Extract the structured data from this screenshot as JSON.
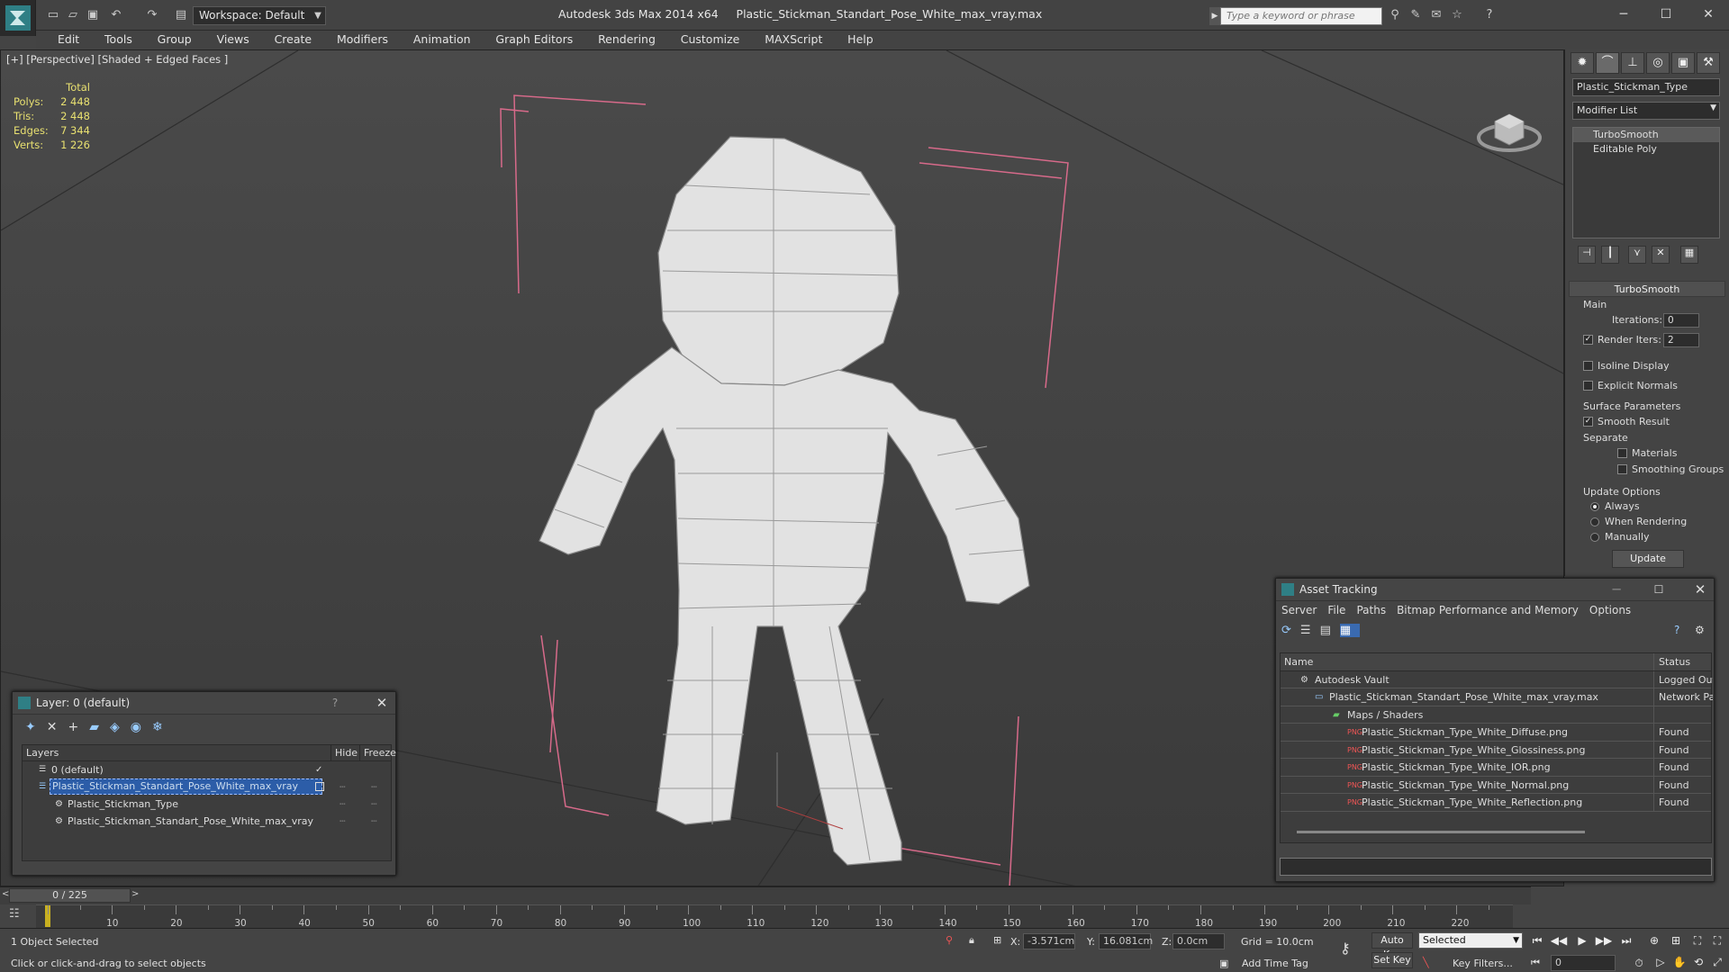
{
  "titlebar": {
    "workspace": "Workspace: Default",
    "app_name": "Autodesk 3ds Max  2014 x64",
    "file_name": "Plastic_Stickman_Standart_Pose_White_max_vray.max",
    "search_placeholder": "Type a keyword or phrase"
  },
  "menu": [
    "Edit",
    "Tools",
    "Group",
    "Views",
    "Create",
    "Modifiers",
    "Animation",
    "Graph Editors",
    "Rendering",
    "Customize",
    "MAXScript",
    "Help"
  ],
  "viewport": {
    "label": "[+] [Perspective] [Shaded + Edged Faces ]",
    "stats": {
      "header": "Total",
      "polys_label": "Polys:",
      "polys": "2 448",
      "tris_label": "Tris:",
      "tris": "2 448",
      "edges_label": "Edges:",
      "edges": "7 344",
      "verts_label": "Verts:",
      "verts": "1 226"
    }
  },
  "command_panel": {
    "object_name": "Plastic_Stickman_Type",
    "modifier_list": "Modifier List",
    "stack": [
      "TurboSmooth",
      "Editable Poly"
    ],
    "rollout_title": "TurboSmooth",
    "main_label": "Main",
    "iterations_label": "Iterations:",
    "iterations": "0",
    "render_iters_label": "Render Iters:",
    "render_iters": "2",
    "isoline_label": "Isoline Display",
    "explicit_normals_label": "Explicit Normals",
    "surface_params_label": "Surface Parameters",
    "smooth_result_label": "Smooth Result",
    "separate_label": "Separate",
    "materials_label": "Materials",
    "smoothing_groups_label": "Smoothing Groups",
    "update_options_label": "Update Options",
    "always_label": "Always",
    "when_rendering_label": "When Rendering",
    "manually_label": "Manually",
    "update_button": "Update"
  },
  "layer_window": {
    "title": "Layer: 0 (default)",
    "help": "?",
    "columns": {
      "layers": "Layers",
      "hide": "Hide",
      "freeze": "Freeze"
    },
    "rows": [
      {
        "name": "0 (default)",
        "indent": 0
      },
      {
        "name": "Plastic_Stickman_Standart_Pose_White_max_vray",
        "indent": 0
      },
      {
        "name": "Plastic_Stickman_Type",
        "indent": 1
      },
      {
        "name": "Plastic_Stickman_Standart_Pose_White_max_vray",
        "indent": 1
      }
    ]
  },
  "asset_window": {
    "title": "Asset Tracking",
    "menu": [
      "Server",
      "File",
      "Paths",
      "Bitmap Performance and Memory",
      "Options"
    ],
    "columns": {
      "name": "Name",
      "status": "Status"
    },
    "rows": [
      {
        "name": "Autodesk Vault",
        "status": "Logged Out",
        "indent": 0
      },
      {
        "name": "Plastic_Stickman_Standart_Pose_White_max_vray.max",
        "status": "Network Path",
        "indent": 1
      },
      {
        "name": "Maps / Shaders",
        "status": "",
        "indent": 2
      },
      {
        "name": "Plastic_Stickman_Type_White_Diffuse.png",
        "status": "Found",
        "indent": 3
      },
      {
        "name": "Plastic_Stickman_Type_White_Glossiness.png",
        "status": "Found",
        "indent": 3
      },
      {
        "name": "Plastic_Stickman_Type_White_IOR.png",
        "status": "Found",
        "indent": 3
      },
      {
        "name": "Plastic_Stickman_Type_White_Normal.png",
        "status": "Found",
        "indent": 3
      },
      {
        "name": "Plastic_Stickman_Type_White_Reflection.png",
        "status": "Found",
        "indent": 3
      }
    ]
  },
  "timeline": {
    "slider": "0 / 225",
    "ticks": [
      "10",
      "20",
      "30",
      "40",
      "50",
      "60",
      "70",
      "80",
      "90",
      "100",
      "110",
      "120",
      "130",
      "140",
      "150",
      "160",
      "170",
      "180",
      "190",
      "200",
      "210",
      "220"
    ]
  },
  "status": {
    "selected": "1 Object Selected",
    "prompt": "Click or click-and-drag to select objects",
    "x_label": "X:",
    "x": "-3.571cm",
    "y_label": "Y:",
    "y": "16.081cm",
    "z_label": "Z:",
    "z": "0.0cm",
    "grid": "Grid = 10.0cm",
    "add_time_tag": "Add Time Tag",
    "auto_key": "Auto Key",
    "set_key": "Set Key",
    "key_mode": "Selected",
    "key_filters": "Key Filters...",
    "frame": "0"
  }
}
